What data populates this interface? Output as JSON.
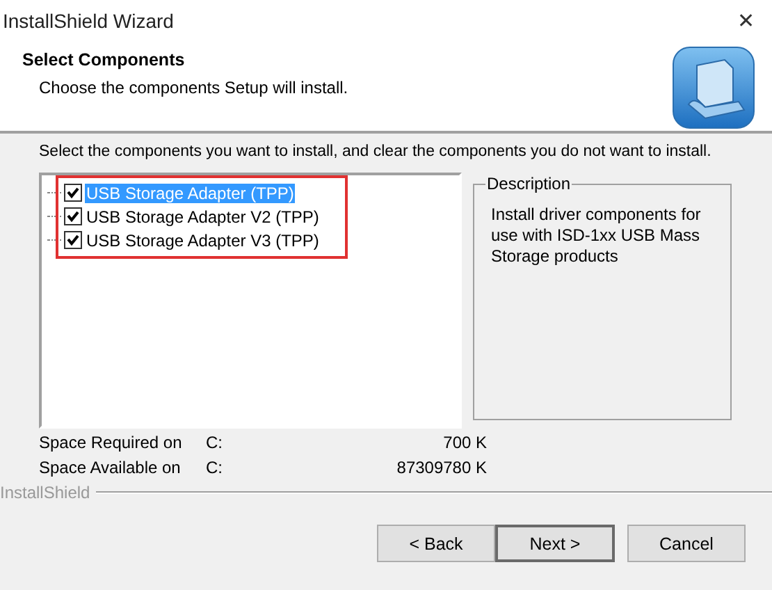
{
  "window": {
    "title": "InstallShield Wizard",
    "close": "✕"
  },
  "header": {
    "title": "Select Components",
    "subtitle": "Choose the components Setup will install."
  },
  "instruction": "Select the components you want to install, and clear the components you do not want to install.",
  "components": [
    {
      "label": "USB Storage Adapter (TPP)",
      "checked": true,
      "selected": true
    },
    {
      "label": "USB Storage Adapter V2 (TPP)",
      "checked": true,
      "selected": false
    },
    {
      "label": "USB Storage Adapter V3 (TPP)",
      "checked": true,
      "selected": false
    }
  ],
  "description": {
    "title": "Description",
    "text": "Install driver components for use with ISD-1xx USB Mass Storage products"
  },
  "space": [
    {
      "label": "Space Required on",
      "drive": "C:",
      "value": "700 K"
    },
    {
      "label": "Space Available on",
      "drive": "C:",
      "value": "87309780 K"
    }
  ],
  "brand": "InstallShield",
  "buttons": [
    {
      "label": "< Back",
      "kind": "normal"
    },
    {
      "label": "Next >",
      "kind": "default"
    },
    {
      "label": "Cancel",
      "kind": "normal"
    }
  ]
}
